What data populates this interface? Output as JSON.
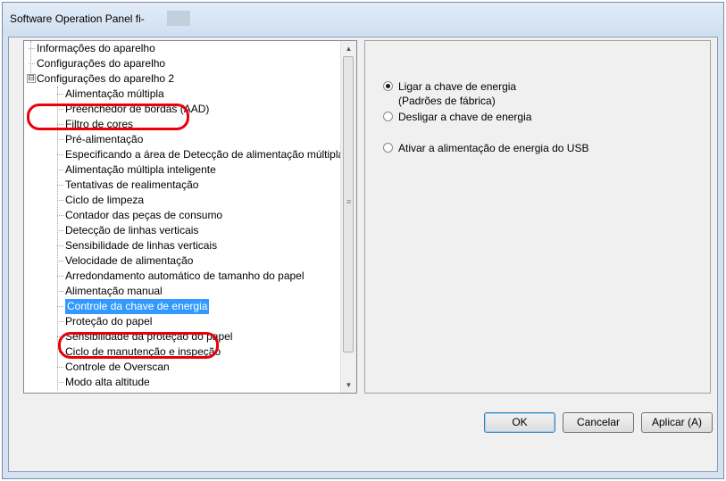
{
  "window": {
    "title": "Software Operation Panel fi-"
  },
  "tree": {
    "items": [
      {
        "label": "Informações do aparelho",
        "level": 0,
        "expander": "",
        "selected": false
      },
      {
        "label": "Configurações do aparelho",
        "level": 0,
        "expander": "",
        "selected": false
      },
      {
        "label": "Configurações do aparelho 2",
        "level": 0,
        "expander": "⊟",
        "selected": false
      },
      {
        "label": "Alimentação múltipla",
        "level": 1,
        "expander": "",
        "selected": false
      },
      {
        "label": "Preenchedor de bordas (AAD)",
        "level": 1,
        "expander": "",
        "selected": false
      },
      {
        "label": "Filtro de cores",
        "level": 1,
        "expander": "",
        "selected": false
      },
      {
        "label": "Pré-alimentação",
        "level": 1,
        "expander": "",
        "selected": false
      },
      {
        "label": "Especificando a área de Detecção de alimentação múltipla",
        "level": 1,
        "expander": "",
        "selected": false
      },
      {
        "label": "Alimentação múltipla inteligente",
        "level": 1,
        "expander": "",
        "selected": false
      },
      {
        "label": "Tentativas de realimentação",
        "level": 1,
        "expander": "",
        "selected": false
      },
      {
        "label": "Ciclo de limpeza",
        "level": 1,
        "expander": "",
        "selected": false
      },
      {
        "label": "Contador das peças de consumo",
        "level": 1,
        "expander": "",
        "selected": false
      },
      {
        "label": "Detecção de linhas verticais",
        "level": 1,
        "expander": "",
        "selected": false
      },
      {
        "label": "Sensibilidade de linhas verticais",
        "level": 1,
        "expander": "",
        "selected": false
      },
      {
        "label": "Velocidade de alimentação",
        "level": 1,
        "expander": "",
        "selected": false
      },
      {
        "label": "Arredondamento automático de tamanho do papel",
        "level": 1,
        "expander": "",
        "selected": false
      },
      {
        "label": "Alimentação manual",
        "level": 1,
        "expander": "",
        "selected": false
      },
      {
        "label": "Controle da chave de energia",
        "level": 1,
        "expander": "",
        "selected": true
      },
      {
        "label": "Proteção do papel",
        "level": 1,
        "expander": "",
        "selected": false
      },
      {
        "label": "Sensibilidade da proteção do papel",
        "level": 1,
        "expander": "",
        "selected": false
      },
      {
        "label": "Ciclo de manutenção e inspeção",
        "level": 1,
        "expander": "",
        "selected": false
      },
      {
        "label": "Controle de Overscan",
        "level": 1,
        "expander": "",
        "selected": false
      },
      {
        "label": "Modo alta altitude",
        "level": 1,
        "expander": "",
        "selected": false
      }
    ]
  },
  "options": {
    "radios": [
      {
        "label": "Ligar a chave de energia",
        "checked": true
      },
      {
        "label": "(Padrões de fábrica)",
        "checked": false,
        "note": true
      },
      {
        "label": "Desligar a chave de energia",
        "checked": false
      },
      {
        "label": "Ativar a alimentação de energia do USB",
        "checked": false
      }
    ]
  },
  "buttons": {
    "ok": "OK",
    "cancel": "Cancelar",
    "apply": "Aplicar (A)"
  },
  "colors": {
    "highlight": "#e8000a",
    "selection": "#3399ff"
  },
  "scrollbar": {
    "up": "▲",
    "down": "▼",
    "grip": "≡"
  }
}
